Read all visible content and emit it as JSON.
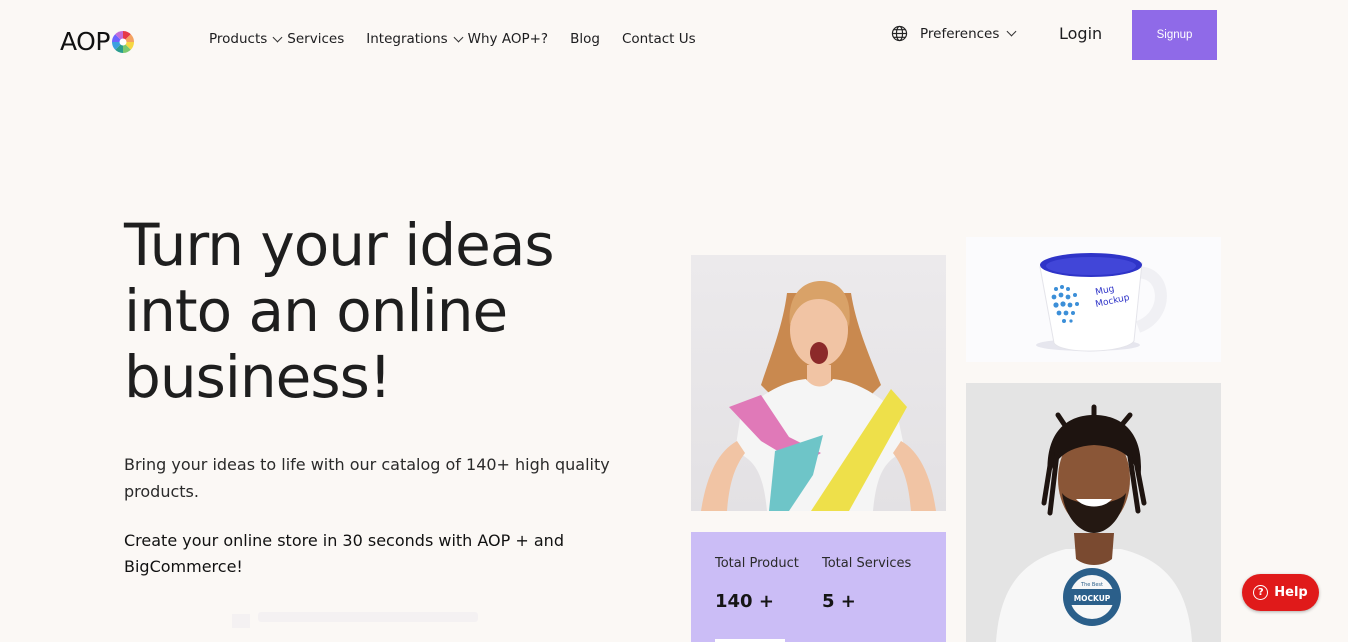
{
  "brand": {
    "logo_text": "AOP"
  },
  "nav": {
    "items": [
      {
        "label": "Products",
        "dropdown": true
      },
      {
        "label": "Services",
        "dropdown": false
      },
      {
        "label": "Integrations",
        "dropdown": true
      },
      {
        "label": "Why AOP+?",
        "dropdown": false
      },
      {
        "label": "Blog",
        "dropdown": false
      },
      {
        "label": "Contact Us",
        "dropdown": false
      }
    ],
    "preferences_label": "Preferences",
    "login_label": "Login",
    "signup_label": "Signup"
  },
  "hero": {
    "title_line1": "Turn your ideas",
    "title_line2": "into an online",
    "title_line3": "business!",
    "subtitle": "Bring your ideas to life with our catalog of 140+ high quality products.",
    "cta": "Create your online store in 30 seconds with AOP + and BigCommerce!"
  },
  "stats": {
    "product_label": "Total Product",
    "product_value": "140 +",
    "services_label": "Total Services",
    "services_value": "5 +"
  },
  "mug_text": {
    "line1": "Mug",
    "line2": "Mockup"
  },
  "shirt_text": {
    "line1": "The Best",
    "line2": "MOCKUP"
  },
  "help": {
    "label": "Help"
  },
  "colors": {
    "accent": "#8f6ae8",
    "stats_bg": "#cbbdf6",
    "help_bg": "#e01a1a",
    "page_bg": "#fbf8f5"
  }
}
